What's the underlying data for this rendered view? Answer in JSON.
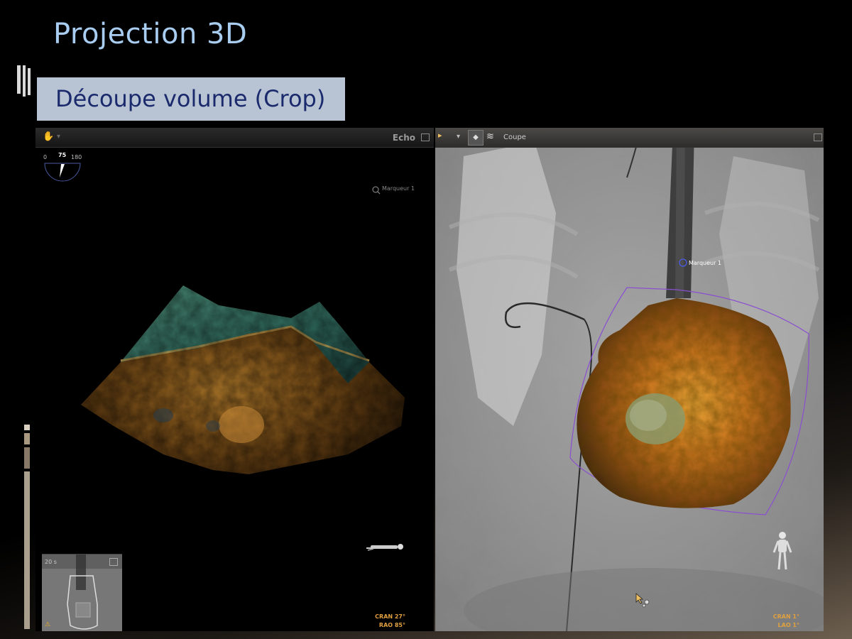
{
  "slide": {
    "title": "Projection 3D",
    "subtitle": "Découpe volume (Crop)"
  },
  "echo_panel": {
    "toolbar_label": "Echo",
    "marker_label": "Marqueur 1",
    "rotation_dial": {
      "min_label": "0",
      "value_label": "75",
      "max_label": "180"
    },
    "angles": {
      "line1": "CRAN  27°",
      "line2": "RAO  85°"
    },
    "thumbnail": {
      "label": "20 s"
    }
  },
  "xray_panel": {
    "toolbar_label": "Coupe",
    "marker_label": "Marqueur 1",
    "angles": {
      "line1": "CRAN  1°",
      "line2": "LAO  1°"
    }
  },
  "colors": {
    "title": "#a8cdf0",
    "subtitle_bg": "#b8c4d4",
    "subtitle_text": "#1a2a6c",
    "angle_text": "#e0a040",
    "crop_outline": "#8a4fd0"
  }
}
